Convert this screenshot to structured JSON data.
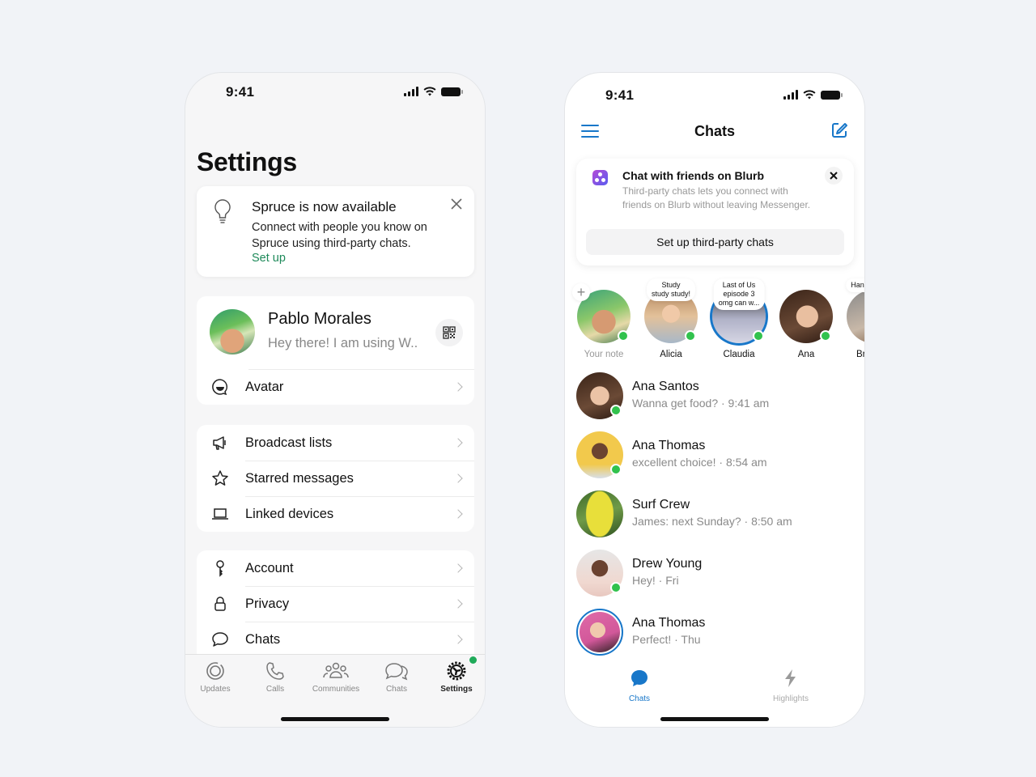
{
  "colors": {
    "background": "#f1f3f7",
    "settings_accent": "#1e8a5a",
    "messenger_accent": "#1877c9",
    "online": "#31c24d"
  },
  "settings_screen": {
    "status_time": "9:41",
    "title": "Settings",
    "promo": {
      "icon": "lightbulb-icon",
      "title": "Spruce is now available",
      "body": "Connect with people you know on Spruce using third-party chats.",
      "link": "Set up",
      "close_icon": "close-icon"
    },
    "profile": {
      "name": "Pablo Morales",
      "status": "Hey there! I am using W..",
      "qr_icon": "qr-code-icon"
    },
    "avatar_row": {
      "icon": "avatar-face-icon",
      "label": "Avatar"
    },
    "group1": [
      {
        "icon": "megaphone-icon",
        "label": "Broadcast lists"
      },
      {
        "icon": "star-icon",
        "label": "Starred messages"
      },
      {
        "icon": "laptop-icon",
        "label": "Linked devices"
      }
    ],
    "group2": [
      {
        "icon": "key-icon",
        "label": "Account"
      },
      {
        "icon": "lock-icon",
        "label": "Privacy"
      },
      {
        "icon": "chat-bubble-icon",
        "label": "Chats"
      }
    ],
    "tabbar": [
      {
        "icon": "updates-icon",
        "label": "Updates",
        "active": false
      },
      {
        "icon": "phone-icon",
        "label": "Calls",
        "active": false
      },
      {
        "icon": "communities-icon",
        "label": "Communities",
        "active": false
      },
      {
        "icon": "chats-icon",
        "label": "Chats",
        "active": false
      },
      {
        "icon": "settings-gear-icon",
        "label": "Settings",
        "active": true,
        "badge": true
      }
    ]
  },
  "chats_screen": {
    "status_time": "9:41",
    "title": "Chats",
    "promo": {
      "title": "Chat with friends on Blurb",
      "body": "Third-party chats lets you connect with friends on Blurb without leaving Messenger.",
      "button": "Set up third-party chats"
    },
    "stories": [
      {
        "name": "Your note",
        "note": "",
        "online": true,
        "own": true
      },
      {
        "name": "Alicia",
        "note": "Study\nstudy study!",
        "online": true
      },
      {
        "name": "Claudia",
        "note": "Last of Us\nepisode 3\nomg can w...",
        "online": true,
        "ring": true
      },
      {
        "name": "Ana",
        "note": "",
        "online": true
      },
      {
        "name": "Br..",
        "note": "Hang",
        "online": false
      }
    ],
    "conversations": [
      {
        "name": "Ana Santos",
        "preview": "Wanna get food? · 9:41 am",
        "online": true
      },
      {
        "name": "Ana Thomas",
        "preview": "excellent choice! · 8:54 am",
        "online": true
      },
      {
        "name": "Surf Crew",
        "preview": "James: next Sunday? · 8:50 am",
        "online": false
      },
      {
        "name": "Drew Young",
        "preview": "Hey! · Fri",
        "online": true
      },
      {
        "name": "Ana Thomas",
        "preview": "Perfect! · Thu",
        "online": false,
        "ring": true
      }
    ],
    "tabbar": [
      {
        "icon": "chats-bubble-icon",
        "label": "Chats",
        "active": true
      },
      {
        "icon": "lightning-icon",
        "label": "Highlights",
        "active": false
      }
    ]
  }
}
